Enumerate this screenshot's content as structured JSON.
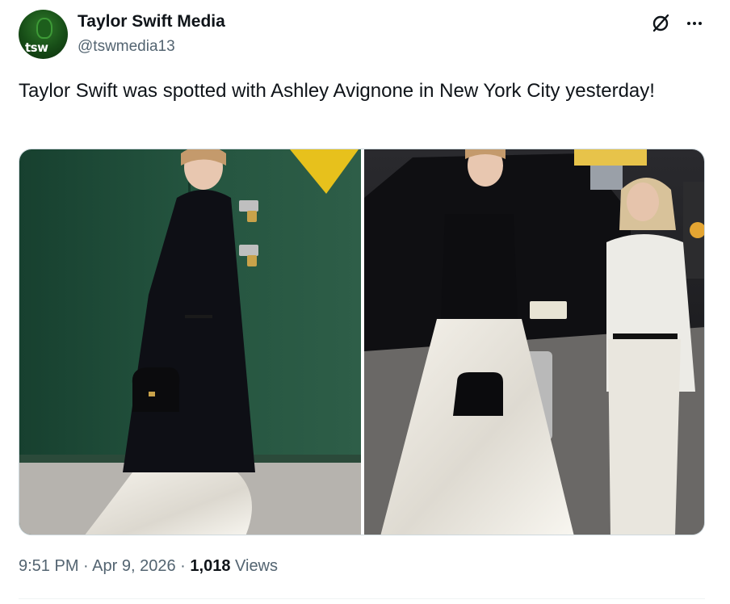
{
  "author": {
    "name": "Taylor Swift Media",
    "handle": "@tswmedia13",
    "avatar_tag": "tsw"
  },
  "icons": {
    "grok": "grok-icon",
    "more": "more-icon"
  },
  "tweet": {
    "text": "Taylor Swift was spotted with Ashley Avignone in New York City yesterday!"
  },
  "meta": {
    "time": "9:51 PM",
    "separator": "·",
    "date": "Apr 9, 2026",
    "views_count": "1,018",
    "views_label": "Views"
  },
  "colors": {
    "text": "#0f1419",
    "secondary": "#536471",
    "border": "#cfd9de"
  }
}
